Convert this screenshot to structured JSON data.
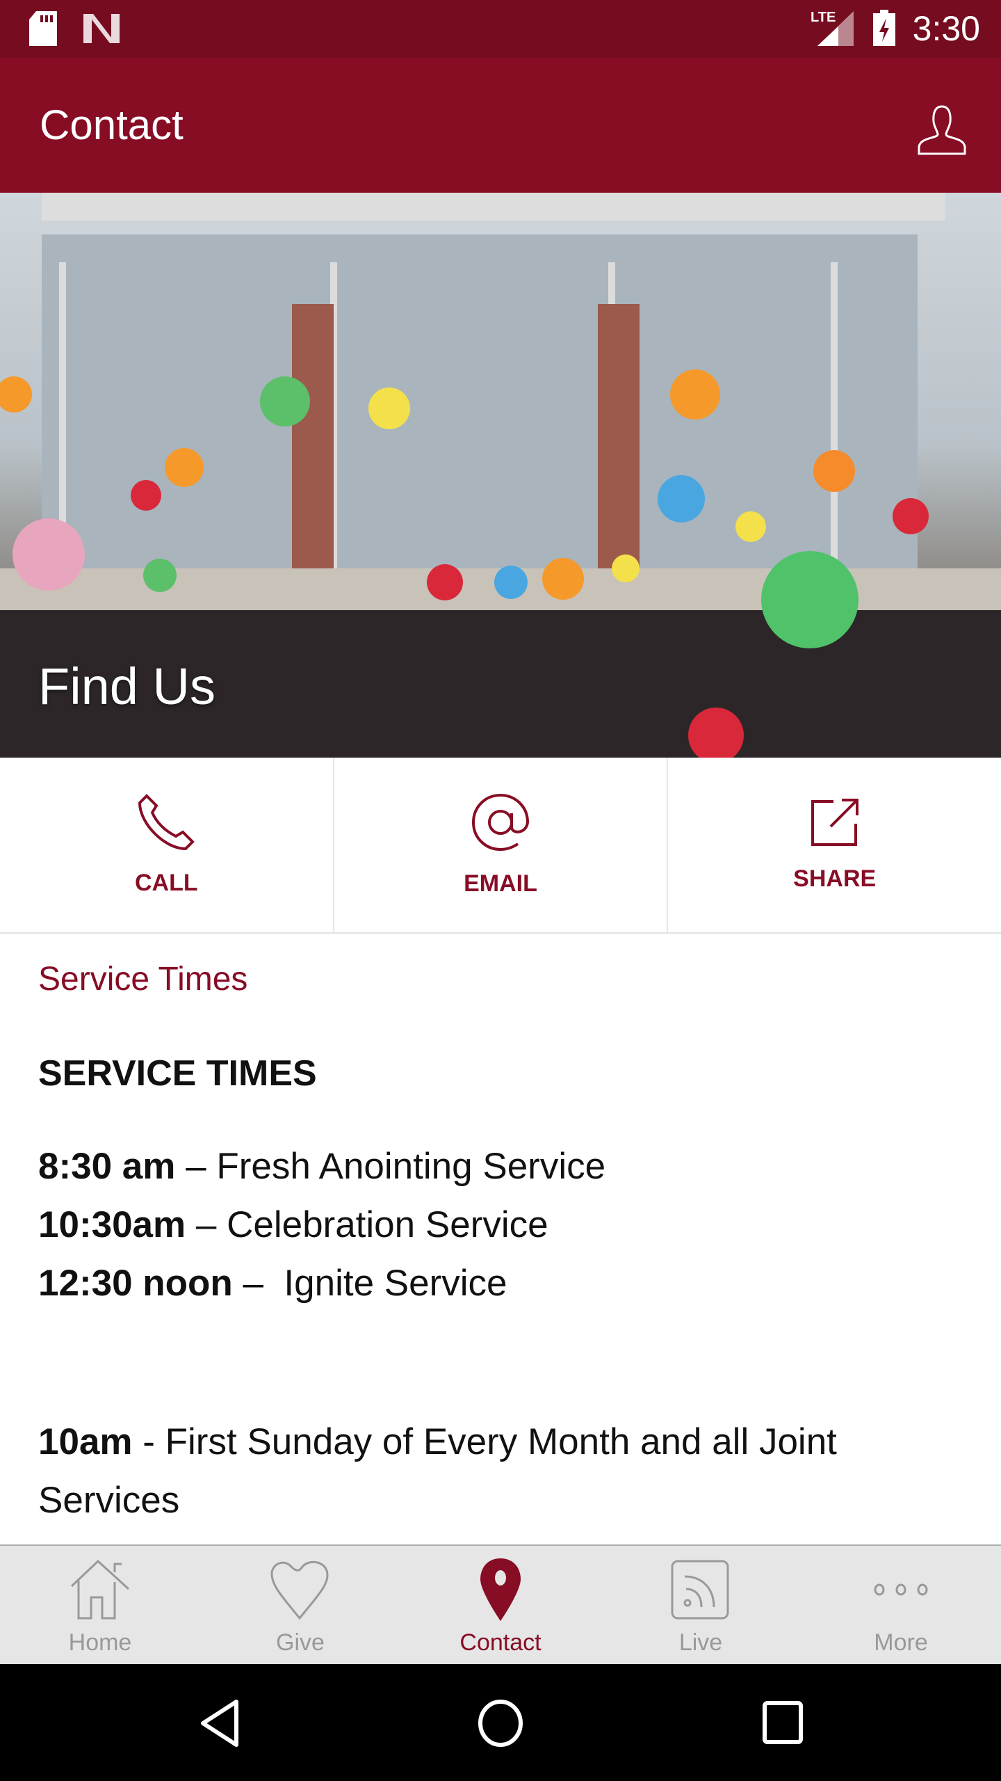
{
  "status_bar": {
    "time": "3:30",
    "network": "LTE",
    "icons": [
      "sd-card-icon",
      "n-notification-icon",
      "signal-icon",
      "battery-charging-icon"
    ]
  },
  "app_bar": {
    "title": "Contact",
    "profile_icon": "person-icon"
  },
  "hero": {
    "caption": "Find Us"
  },
  "actions": [
    {
      "label": "CALL",
      "icon": "phone-icon"
    },
    {
      "label": "EMAIL",
      "icon": "at-icon"
    },
    {
      "label": "SHARE",
      "icon": "share-icon"
    }
  ],
  "content": {
    "link": "Service Times",
    "heading": "SERVICE TIMES",
    "times": [
      {
        "time": "8:30 am",
        "desc": " – Fresh Anointing Service"
      },
      {
        "time": "10:30am",
        "desc": " – Celebration Service"
      },
      {
        "time": "12:30 noon",
        "desc": " –  Ignite Service"
      }
    ],
    "note": {
      "time": "10am",
      "desc": " - First Sunday of Every Month and all Joint Services"
    }
  },
  "tabs": [
    {
      "label": "Home",
      "icon": "home-icon"
    },
    {
      "label": "Give",
      "icon": "heart-icon"
    },
    {
      "label": "Contact",
      "icon": "location-pin-icon",
      "active": true
    },
    {
      "label": "Live",
      "icon": "rss-icon"
    },
    {
      "label": "More",
      "icon": "more-dots-icon"
    }
  ],
  "colors": {
    "brand": "#870d25",
    "status_bar": "#750c20",
    "tab_bar": "#e6e6e6",
    "inactive": "#999999"
  }
}
